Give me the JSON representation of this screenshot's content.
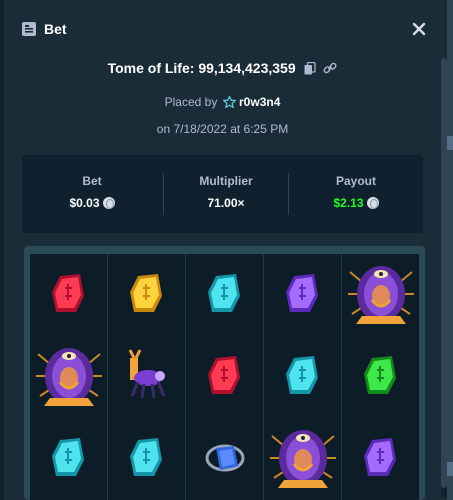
{
  "modal": {
    "title": "Bet",
    "game_name": "Tome of Life:",
    "bet_id": "99,134,423,359",
    "placed_by_prefix": "Placed by",
    "username": "r0w3n4",
    "date_prefix": "on",
    "date": "7/18/2022 at 6:25 PM"
  },
  "stats": {
    "bet_label": "Bet",
    "bet_value": "$0.03",
    "multiplier_label": "Multiplier",
    "multiplier_value": "71.00×",
    "payout_label": "Payout",
    "payout_value": "$2.13",
    "payout_color": "#1fff20"
  },
  "reels": {
    "grid": [
      [
        "red-gem",
        "gold-gem",
        "cyan-gem",
        "purple-gem",
        "sorceress-wild"
      ],
      [
        "sorceress-wild",
        "spider-creature",
        "red-gem",
        "cyan-gem",
        "green-gem"
      ],
      [
        "cyan-gem",
        "cyan-gem",
        "blue-orb",
        "sorceress-wild",
        "purple-gem"
      ]
    ]
  },
  "colors": {
    "background": "#1a2c38",
    "panel": "#0f212e",
    "muted_text": "#b1bad3",
    "accent_cyan": "#5ec8d8"
  }
}
